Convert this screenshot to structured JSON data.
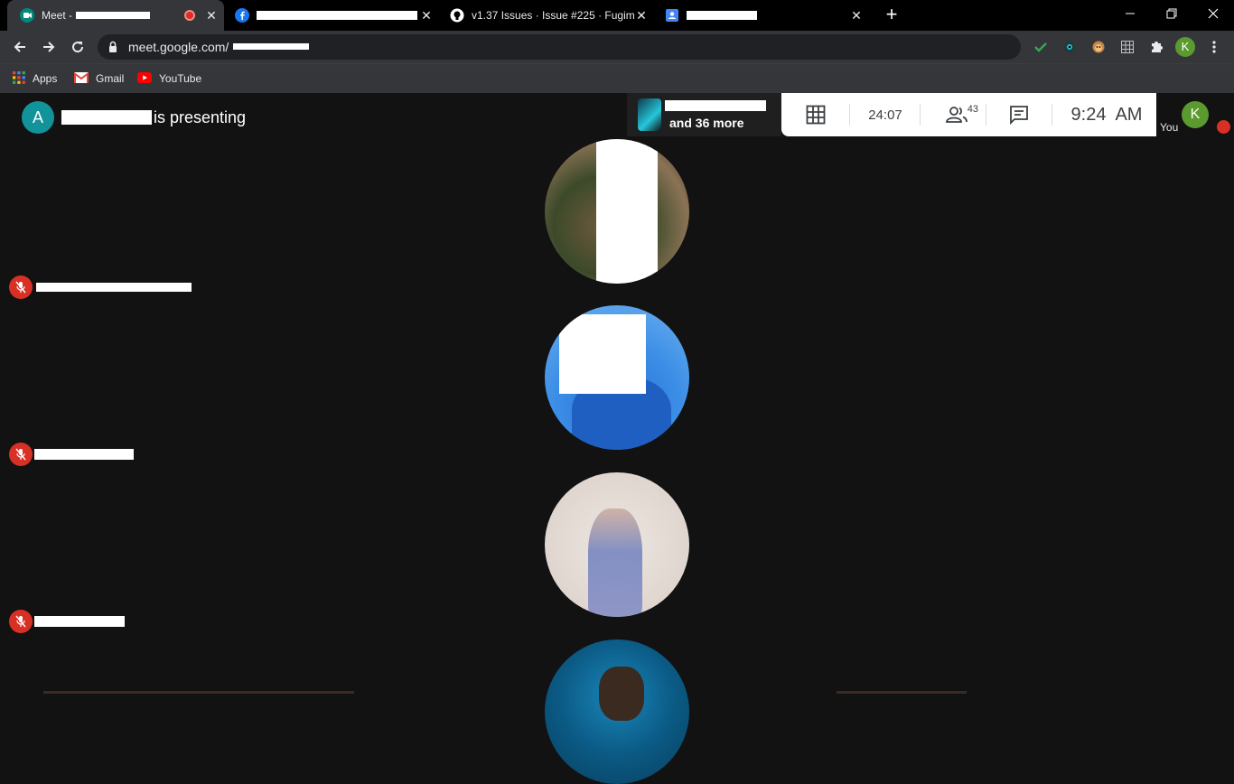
{
  "browser": {
    "tabs": [
      {
        "label": "Meet -",
        "icon": "meet-icon",
        "recording": true
      },
      {
        "label": "",
        "icon": "facebook-icon"
      },
      {
        "label": "v1.37 Issues · Issue #225 · Fugima",
        "icon": "github-icon"
      },
      {
        "label": "",
        "icon": "contacts-icon"
      }
    ],
    "new_tab": "+",
    "url": "meet.google.com/",
    "bookmarks": [
      {
        "label": "Apps",
        "icon": "apps-grid-icon"
      },
      {
        "label": "Gmail",
        "icon": "gmail-icon"
      },
      {
        "label": "YouTube",
        "icon": "youtube-icon"
      }
    ],
    "profile_initial": "K"
  },
  "meet": {
    "presenter_initial": "A",
    "presenter_text": "is presenting",
    "more_participants": "and 36 more",
    "timer": "24:07",
    "participant_count": "43",
    "clock": "9:24",
    "clock_suffix": "AM",
    "self_initial": "K",
    "self_label": "You"
  },
  "colors": {
    "meet_bg": "#121212",
    "mic_off_red": "#d93025",
    "presenter_avatar": "#12939a",
    "self_avatar": "#5b9a2e"
  }
}
